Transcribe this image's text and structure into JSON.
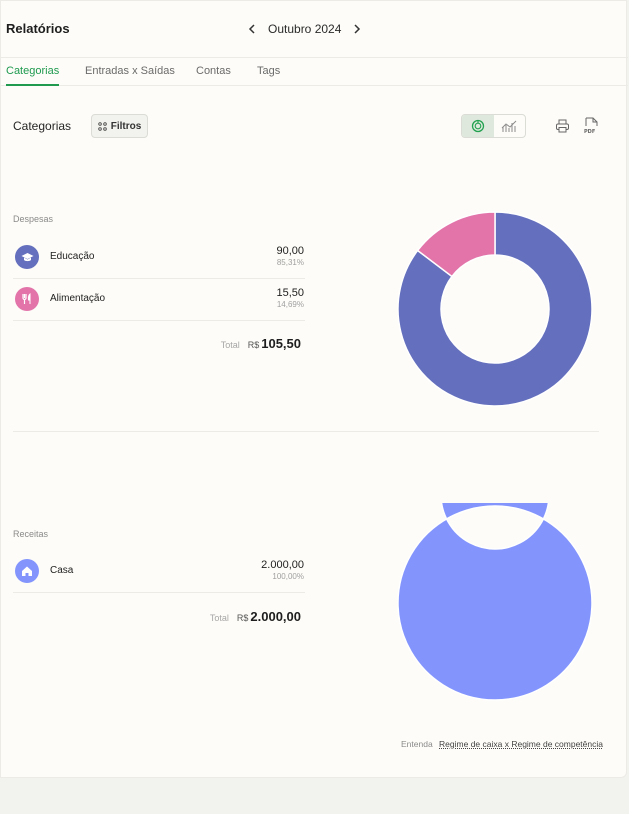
{
  "header": {
    "title": "Relatórios",
    "month": "Outubro 2024"
  },
  "tabs": [
    {
      "label": "Categorias",
      "active": true
    },
    {
      "label": "Entradas x Saídas",
      "active": false
    },
    {
      "label": "Contas",
      "active": false
    },
    {
      "label": "Tags",
      "active": false
    }
  ],
  "toolbar": {
    "section_title": "Categorias",
    "filter_label": "Filtros",
    "pdf_label": "PDF"
  },
  "despesas": {
    "label": "Despesas",
    "items": [
      {
        "name": "Educação",
        "value": "90,00",
        "percent": "85,31%",
        "color": "#6470bd",
        "icon": "graduation-cap-icon"
      },
      {
        "name": "Alimentação",
        "value": "15,50",
        "percent": "14,69%",
        "color": "#e274aa",
        "icon": "fork-knife-icon"
      }
    ],
    "total_label": "Total",
    "currency": "R$",
    "total": "105,50"
  },
  "receitas": {
    "label": "Receitas",
    "items": [
      {
        "name": "Casa",
        "value": "2.000,00",
        "percent": "100,00%",
        "color": "#8395fd",
        "icon": "house-icon"
      }
    ],
    "total_label": "Total",
    "currency": "R$",
    "total": "2.000,00"
  },
  "footer": {
    "prefix": "Entenda",
    "link": "Regime de caixa x Regime de competência"
  },
  "chart_data": [
    {
      "type": "pie",
      "categories": [
        "Educação",
        "Alimentação"
      ],
      "values": [
        90.0,
        15.5
      ],
      "colors": [
        "#6470bd",
        "#e274aa"
      ]
    },
    {
      "type": "pie",
      "categories": [
        "Casa"
      ],
      "values": [
        2000.0
      ],
      "colors": [
        "#8395fd"
      ]
    }
  ]
}
